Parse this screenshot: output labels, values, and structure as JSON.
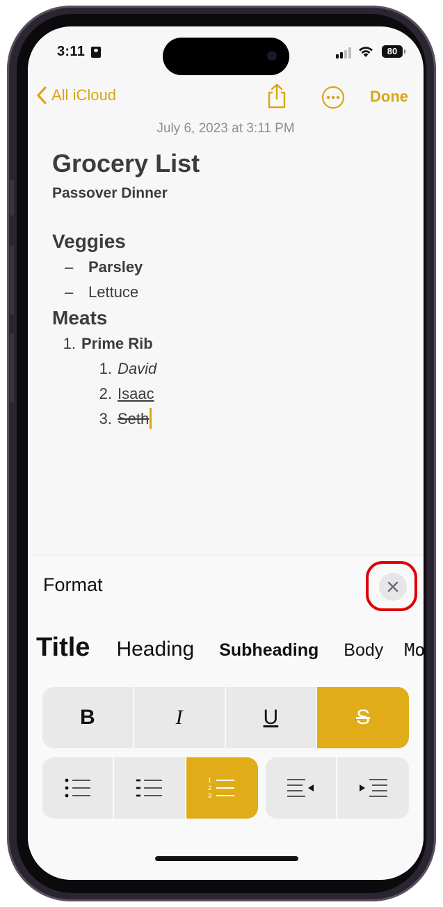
{
  "status_bar": {
    "time": "3:11",
    "battery": "80"
  },
  "nav": {
    "back_label": "All iCloud",
    "done_label": "Done"
  },
  "note": {
    "date": "July 6, 2023 at 3:11 PM",
    "title": "Grocery List",
    "subtitle": "Passover Dinner",
    "sections": [
      {
        "heading": "Veggies",
        "items": [
          "Parsley",
          "Lettuce"
        ]
      },
      {
        "heading": "Meats",
        "items": [
          "Prime Rib"
        ],
        "subitems": [
          "David",
          "Isaac",
          "Seth"
        ]
      }
    ],
    "markers": {
      "dash": "–",
      "n1": "1.",
      "n2": "2.",
      "n3": "3."
    }
  },
  "format_panel": {
    "title": "Format",
    "styles": [
      "Title",
      "Heading",
      "Subheading",
      "Body",
      "Monostyled"
    ],
    "text_buttons": {
      "bold": "B",
      "italic": "I",
      "underline": "U",
      "strikethrough": "S"
    },
    "active": [
      "strikethrough",
      "numbered-list"
    ]
  },
  "colors": {
    "accent": "#e0ac18",
    "highlight": "#e00000"
  },
  "icons": [
    "back-chevron-icon",
    "share-icon",
    "more-icon",
    "close-icon",
    "bulleted-list-icon",
    "dashed-list-icon",
    "numbered-list-icon",
    "outdent-icon",
    "indent-icon"
  ]
}
